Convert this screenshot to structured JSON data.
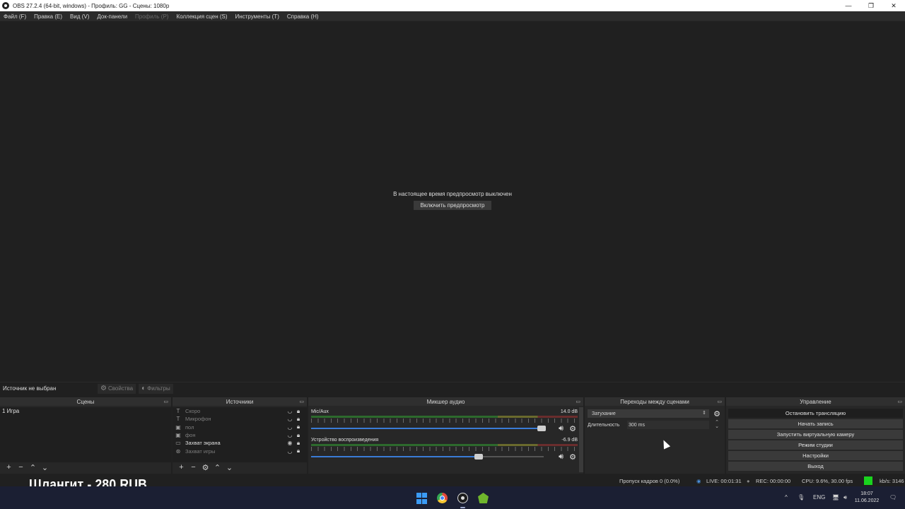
{
  "window": {
    "title": "OBS 27.2.4 (64-bit, windows) - Профиль: GG - Сцены: 1080p",
    "minimize": "—",
    "maximize": "❐",
    "close": "✕"
  },
  "menu": {
    "items": [
      {
        "label": "Файл (F)",
        "disabled": false
      },
      {
        "label": "Правка (E)",
        "disabled": false
      },
      {
        "label": "Вид (V)",
        "disabled": false
      },
      {
        "label": "Док-панели",
        "disabled": false
      },
      {
        "label": "Профиль (P)",
        "disabled": true
      },
      {
        "label": "Коллекция сцен (S)",
        "disabled": false
      },
      {
        "label": "Инструменты (T)",
        "disabled": false
      },
      {
        "label": "Справка (H)",
        "disabled": false
      }
    ]
  },
  "preview": {
    "message": "В настоящее время предпросмотр выключен",
    "enable_button": "Включить предпросмотр"
  },
  "context": {
    "no_source": "Источник не выбран",
    "properties": "Свойства",
    "filters": "Фильтры"
  },
  "scenes": {
    "title": "Сцены",
    "items": [
      "1 Игра"
    ]
  },
  "sources": {
    "title": "Источники",
    "items": [
      {
        "name": "Скоро",
        "icon": "text-icon",
        "visible": false
      },
      {
        "name": "Микрофон",
        "icon": "text-icon",
        "visible": false
      },
      {
        "name": "пол",
        "icon": "image-icon",
        "visible": false
      },
      {
        "name": "фон",
        "icon": "image-icon",
        "visible": false
      },
      {
        "name": "Захват экрана",
        "icon": "monitor-icon",
        "visible": true
      },
      {
        "name": "Захват игры",
        "icon": "gamepad-icon",
        "visible": false
      }
    ]
  },
  "mixer": {
    "title": "Микшер аудио",
    "channels": [
      {
        "name": "Mic/Aux",
        "db": "14.0 dB",
        "volume": 0.99,
        "level": 0.0
      },
      {
        "name": "Устройство воспроизведения",
        "db": "-6.9 dB",
        "volume": 0.72,
        "level": 0.0
      }
    ]
  },
  "transitions": {
    "title": "Переходы между сценами",
    "selected": "Затухание",
    "duration_label": "Длительность",
    "duration_value": "300 ms"
  },
  "controls": {
    "title": "Управление",
    "buttons": [
      "Остановить трансляцию",
      "Начать запись",
      "Запустить виртуальную камеру",
      "Режим студии",
      "Настройки",
      "Выход"
    ]
  },
  "status": {
    "dropped_frames": "Пропуск кадров 0 (0.0%)",
    "live": "LIVE: 00:01:31",
    "rec": "REC: 00:00:00",
    "cpu": "CPU: 9.6%, 30.00 fps",
    "kbps": "kb/s: 3146",
    "indicator_color": "#19d31e"
  },
  "overlay": {
    "text": "Шлангит - 280 RUB"
  },
  "taskbar": {
    "lang": "ENG",
    "time": "18:07",
    "date": "11.06.2022",
    "caret": "^"
  }
}
